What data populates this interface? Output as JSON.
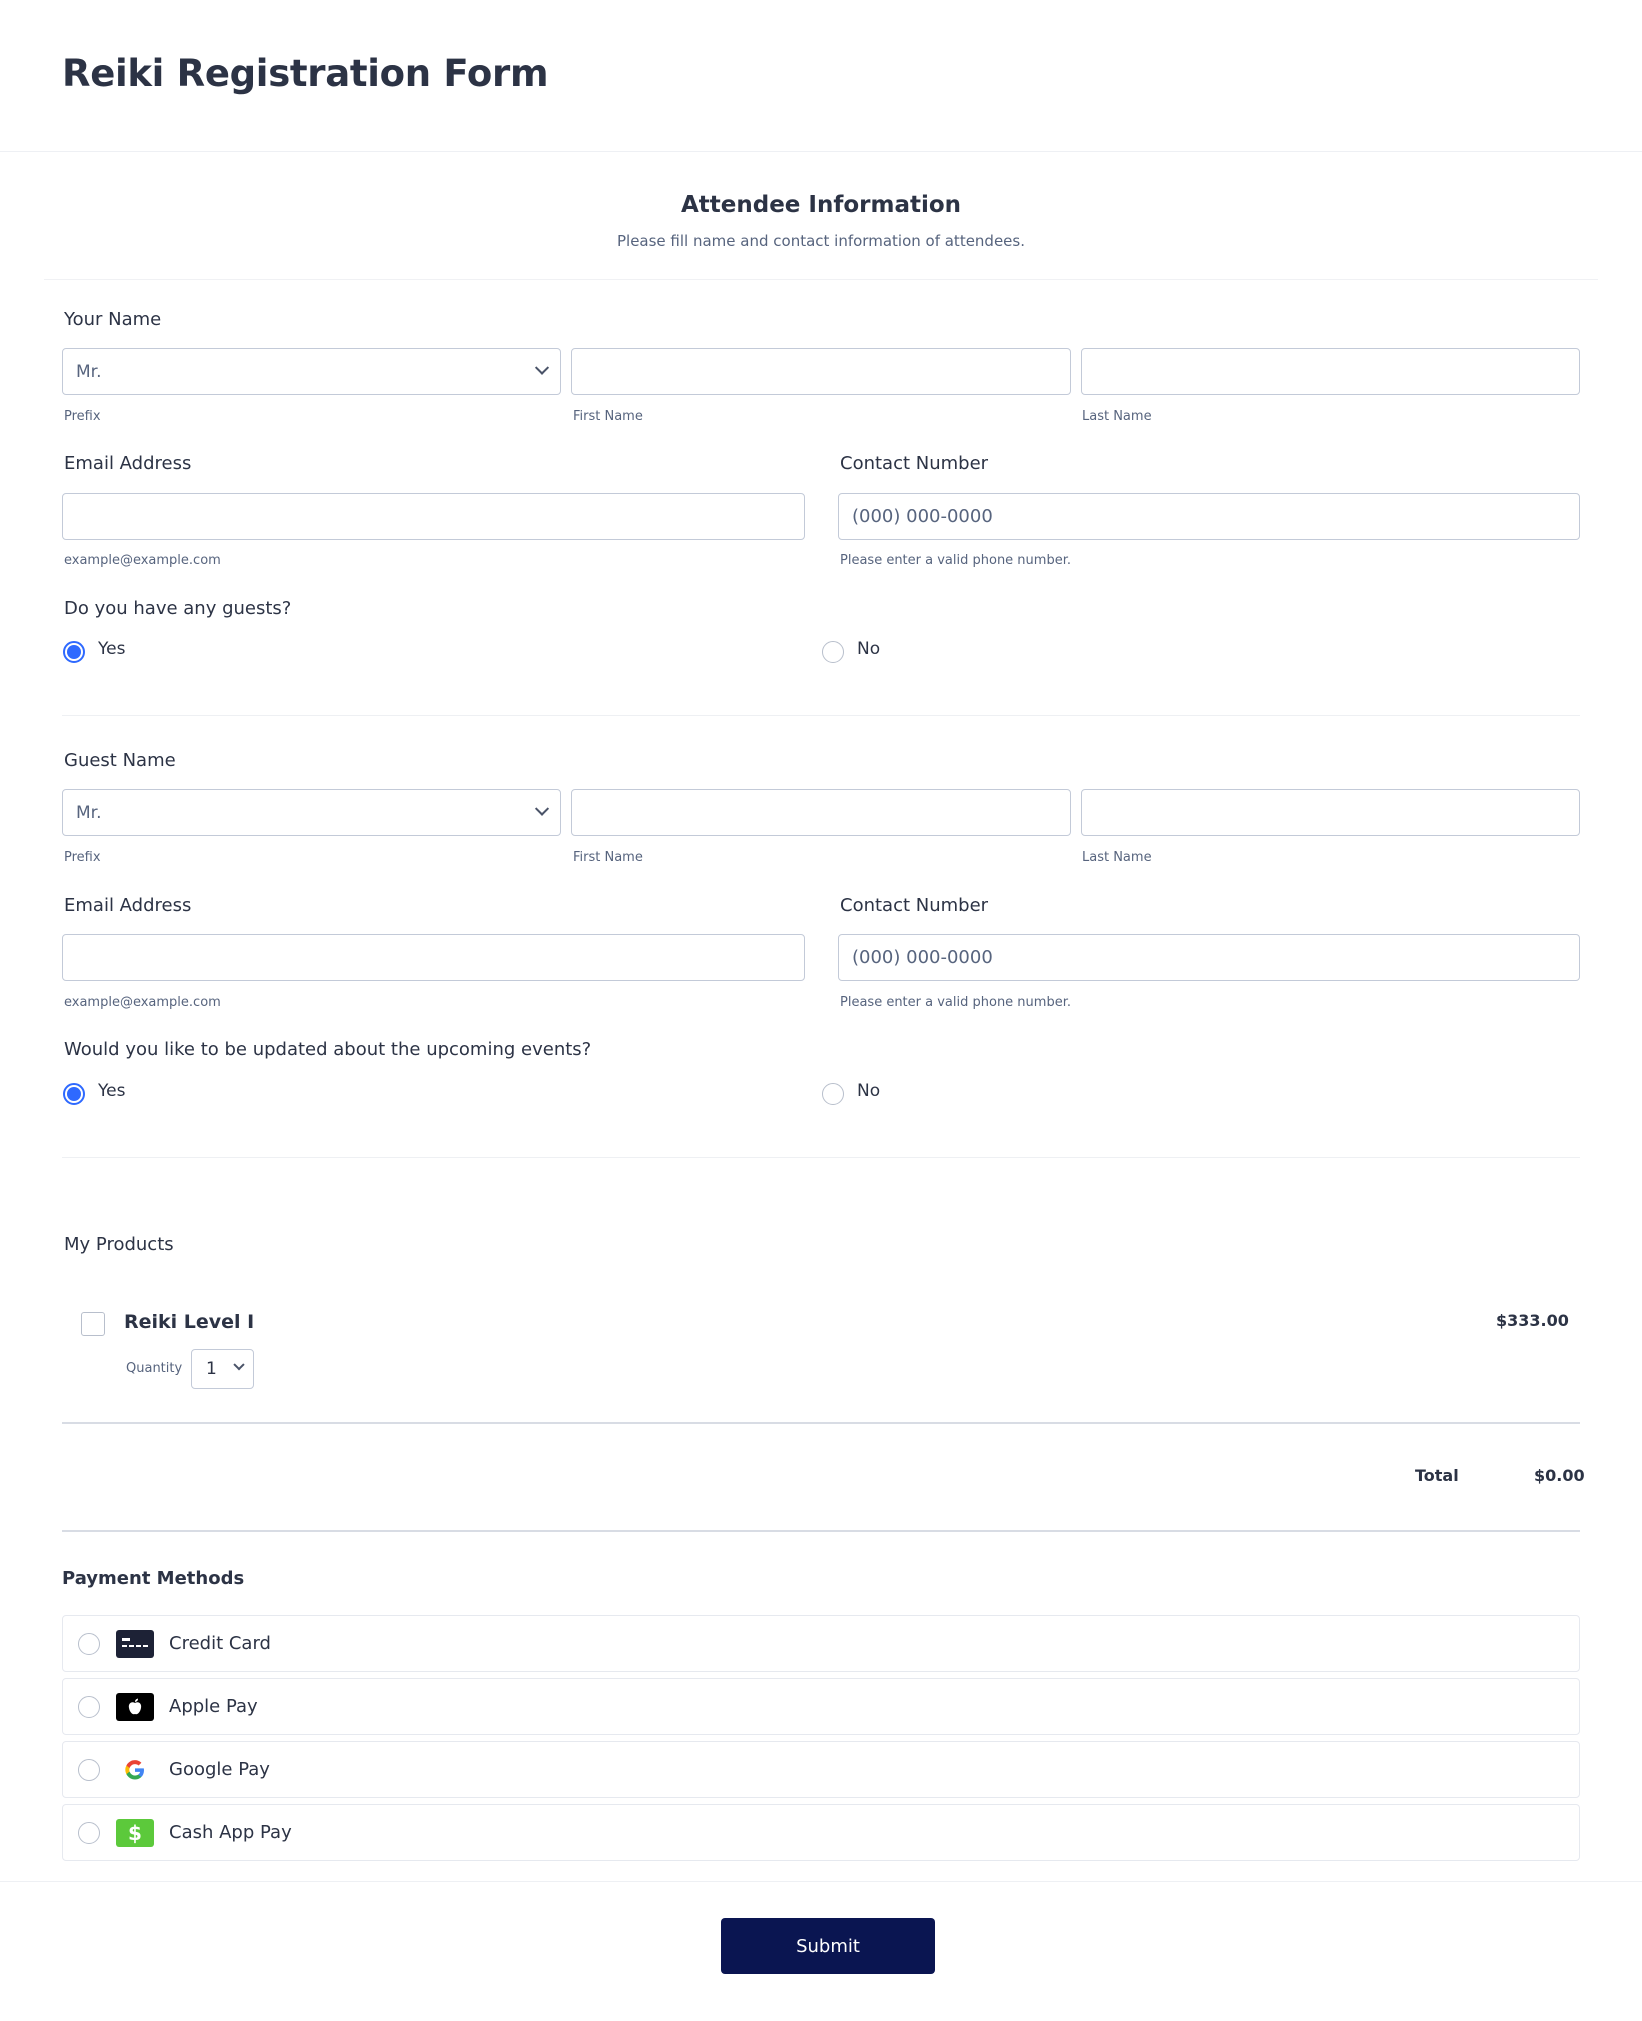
{
  "header": {
    "title": "Reiki Registration Form"
  },
  "attendee": {
    "title": "Attendee Information",
    "subtitle": "Please fill name and contact information of attendees."
  },
  "your_name": {
    "label": "Your Name",
    "prefix_value": "Mr.",
    "prefix_sub": "Prefix",
    "first_sub": "First Name",
    "last_sub": "Last Name"
  },
  "your_email": {
    "label": "Email Address",
    "sub": "example@example.com"
  },
  "your_phone": {
    "label": "Contact Number",
    "placeholder": "(000) 000-0000",
    "sub": "Please enter a valid phone number."
  },
  "guests_q": {
    "label": "Do you have any guests?",
    "yes": "Yes",
    "no": "No",
    "selected": "Yes"
  },
  "guest_name": {
    "label": "Guest Name",
    "prefix_value": "Mr.",
    "prefix_sub": "Prefix",
    "first_sub": "First Name",
    "last_sub": "Last Name"
  },
  "guest_email": {
    "label": "Email Address",
    "sub": "example@example.com"
  },
  "guest_phone": {
    "label": "Contact Number",
    "placeholder": "(000) 000-0000",
    "sub": "Please enter a valid phone number."
  },
  "updates_q": {
    "label": "Would you like to be updated about the upcoming events?",
    "yes": "Yes",
    "no": "No",
    "selected": "Yes"
  },
  "products": {
    "label": "My Products",
    "items": [
      {
        "name": "Reiki Level I",
        "price": "$333.00",
        "quantity_label": "Quantity",
        "quantity": "1"
      }
    ],
    "total_label": "Total",
    "total_value": "$0.00"
  },
  "payment": {
    "label": "Payment Methods",
    "methods": [
      {
        "label": "Credit Card",
        "icon": "credit-card-icon"
      },
      {
        "label": "Apple Pay",
        "icon": "apple-icon"
      },
      {
        "label": "Google Pay",
        "icon": "google-icon"
      },
      {
        "label": "Cash App Pay",
        "icon": "cash-app-icon"
      }
    ]
  },
  "submit": {
    "label": "Submit"
  },
  "colors": {
    "accent": "#2e69ff",
    "submit_bg": "#0a1551",
    "text": "#2c3345",
    "muted": "#57647e",
    "cash_app": "#5cc93b"
  }
}
